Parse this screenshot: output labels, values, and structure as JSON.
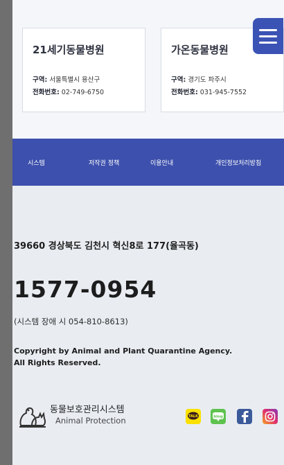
{
  "hospitals": [
    {
      "name": "21세기동물병원",
      "region_label": "구역:",
      "region": "서울특별시 용산구",
      "phone_label": "전화번호:",
      "phone": "02-749-6750"
    },
    {
      "name": "가온동물병원",
      "region_label": "구역:",
      "region": "경기도 파주시",
      "phone_label": "전화번호:",
      "phone": "031-945-7552"
    }
  ],
  "nav": {
    "items": [
      "시스템",
      "저작권 정책",
      "이용안내",
      "개인정보처리방침"
    ]
  },
  "footer": {
    "address": "39660 경상북도 김천시 혁신8로 177(율곡동)",
    "phone": "1577-0954",
    "sub_phone": "(시스템 장애 시 054-810-8613)",
    "copyright_1": "Copyright by Animal and Plant Quarantine Agency.",
    "copyright_2": "All Rights Reserved.",
    "logo_kr": "동물보호관리시스템",
    "logo_en": "Animal Protection"
  },
  "social": {
    "talk_label": "TALK",
    "blog_label": "blog",
    "facebook_icon": "facebook-icon",
    "instagram_icon": "instagram-icon"
  },
  "colors": {
    "nav_bg": "#3d50ad",
    "menu_btn": "#3b53b5",
    "page_bg": "#e9edf2"
  }
}
